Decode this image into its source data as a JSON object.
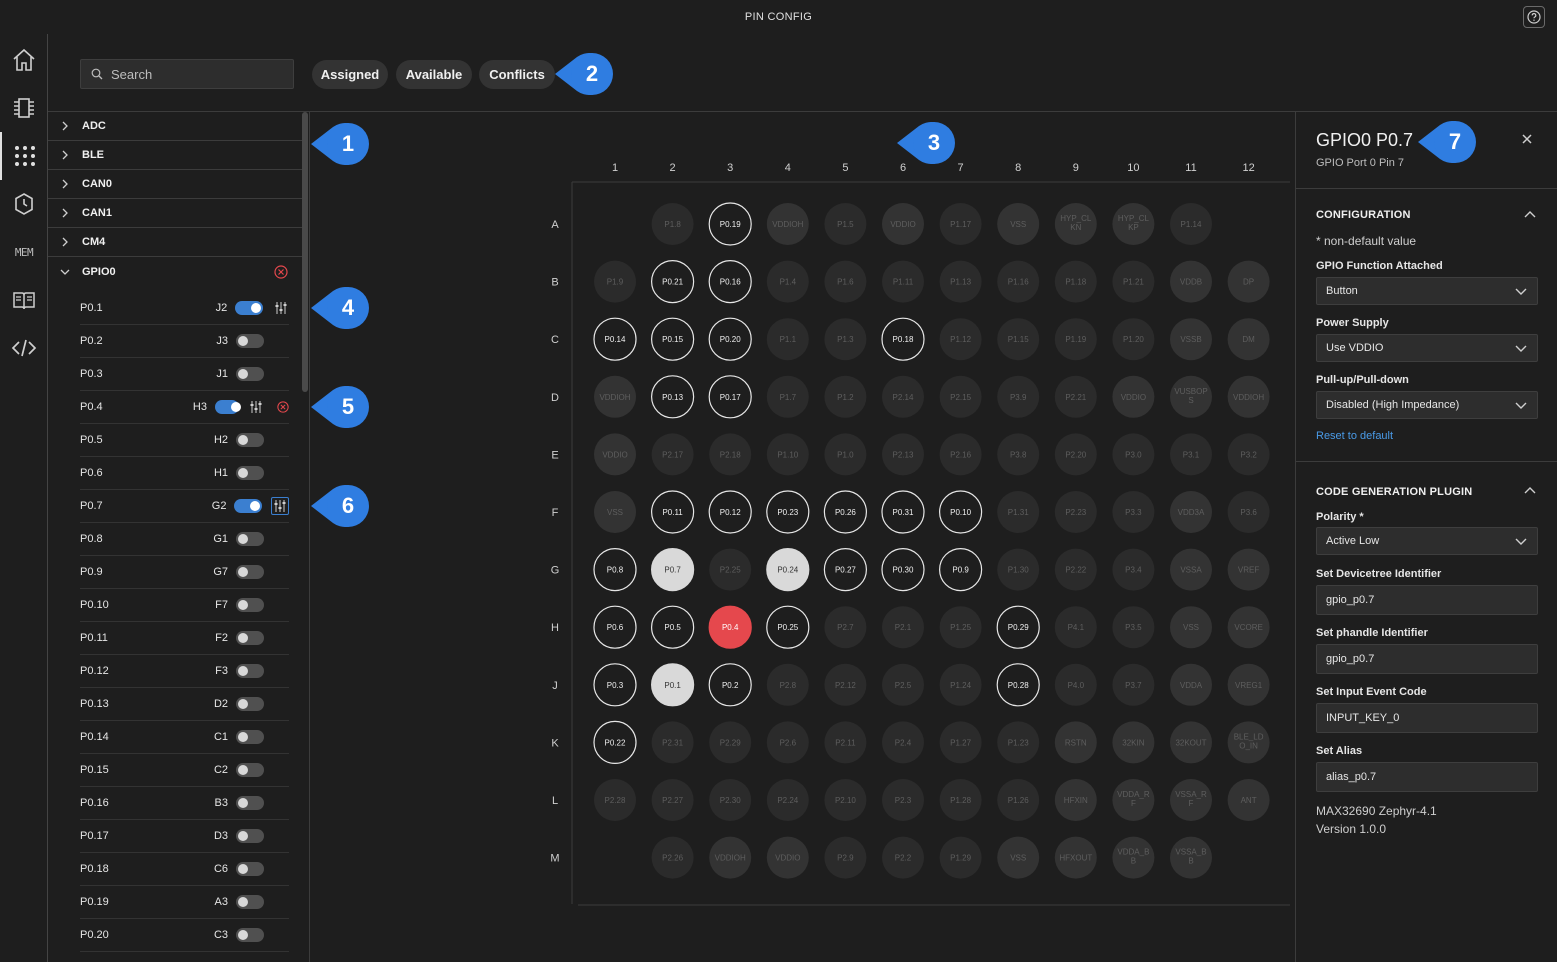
{
  "window": {
    "title": "PIN CONFIG"
  },
  "activity_bar": [
    {
      "name": "home-icon"
    },
    {
      "name": "device-icon"
    },
    {
      "name": "pin-grid-icon",
      "active": true
    },
    {
      "name": "clock-icon"
    },
    {
      "name": "mem-icon",
      "label": "MEM"
    },
    {
      "name": "book-icon"
    },
    {
      "name": "code-icon"
    }
  ],
  "toolbar": {
    "search_placeholder": "Search",
    "filters": [
      "Assigned",
      "Available",
      "Conflicts"
    ]
  },
  "callouts": [
    "1",
    "2",
    "3",
    "4",
    "5",
    "6",
    "7"
  ],
  "peripherals": {
    "collapsed_groups": [
      "ADC",
      "BLE",
      "CAN0",
      "CAN1",
      "CM4"
    ],
    "expanded_group": {
      "label": "GPIO0",
      "has_conflict": true
    },
    "pins": [
      {
        "name": "P0.1",
        "loc": "J2",
        "on": true,
        "tune": true
      },
      {
        "name": "P0.2",
        "loc": "J3",
        "on": false
      },
      {
        "name": "P0.3",
        "loc": "J1",
        "on": false
      },
      {
        "name": "P0.4",
        "loc": "H3",
        "on": true,
        "tune": true,
        "conflict": true
      },
      {
        "name": "P0.5",
        "loc": "H2",
        "on": false
      },
      {
        "name": "P0.6",
        "loc": "H1",
        "on": false
      },
      {
        "name": "P0.7",
        "loc": "G2",
        "on": true,
        "tune": true,
        "selected": true
      },
      {
        "name": "P0.8",
        "loc": "G1",
        "on": false
      },
      {
        "name": "P0.9",
        "loc": "G7",
        "on": false
      },
      {
        "name": "P0.10",
        "loc": "F7",
        "on": false
      },
      {
        "name": "P0.11",
        "loc": "F2",
        "on": false
      },
      {
        "name": "P0.12",
        "loc": "F3",
        "on": false
      },
      {
        "name": "P0.13",
        "loc": "D2",
        "on": false
      },
      {
        "name": "P0.14",
        "loc": "C1",
        "on": false
      },
      {
        "name": "P0.15",
        "loc": "C2",
        "on": false
      },
      {
        "name": "P0.16",
        "loc": "B3",
        "on": false
      },
      {
        "name": "P0.17",
        "loc": "D3",
        "on": false
      },
      {
        "name": "P0.18",
        "loc": "C6",
        "on": false
      },
      {
        "name": "P0.19",
        "loc": "A3",
        "on": false
      },
      {
        "name": "P0.20",
        "loc": "C3",
        "on": false
      }
    ]
  },
  "package": {
    "columns": [
      "1",
      "2",
      "3",
      "4",
      "5",
      "6",
      "7",
      "8",
      "9",
      "10",
      "11",
      "12"
    ],
    "rows": [
      "A",
      "B",
      "C",
      "D",
      "E",
      "F",
      "G",
      "H",
      "J",
      "K",
      "L",
      "M"
    ],
    "pins": [
      [
        "",
        "P1.8",
        "P0.19",
        "VDDIOH",
        "P1.5",
        "VDDIO",
        "P1.17",
        "VSS",
        "HYP_CL KN",
        "HYP_CL KP",
        "P1.14",
        ""
      ],
      [
        "P1.9",
        "P0.21",
        "P0.16",
        "P1.4",
        "P1.6",
        "P1.11",
        "P1.13",
        "P1.16",
        "P1.18",
        "P1.21",
        "VDDB",
        "DP"
      ],
      [
        "P0.14",
        "P0.15",
        "P0.20",
        "P1.1",
        "P1.3",
        "P0.18",
        "P1.12",
        "P1.15",
        "P1.19",
        "P1.20",
        "VSSB",
        "DM"
      ],
      [
        "VDDIOH",
        "P0.13",
        "P0.17",
        "P1.7",
        "P1.2",
        "P2.14",
        "P2.15",
        "P3.9",
        "P2.21",
        "VDDIO",
        "VUSBOP S",
        "VDDIOH"
      ],
      [
        "VDDIO",
        "P2.17",
        "P2.18",
        "P1.10",
        "P1.0",
        "P2.13",
        "P2.16",
        "P3.8",
        "P2.20",
        "P3.0",
        "P3.1",
        "P3.2"
      ],
      [
        "VSS",
        "P0.11",
        "P0.12",
        "P0.23",
        "P0.26",
        "P0.31",
        "P0.10",
        "P1.31",
        "P2.23",
        "P3.3",
        "VDD3A",
        "P3.6"
      ],
      [
        "P0.8",
        "P0.7",
        "P2.25",
        "P0.24",
        "P0.27",
        "P0.30",
        "P0.9",
        "P1.30",
        "P2.22",
        "P3.4",
        "VSSA",
        "VREF"
      ],
      [
        "P0.6",
        "P0.5",
        "P0.4",
        "P0.25",
        "P2.7",
        "P2.1",
        "P1.25",
        "P0.29",
        "P4.1",
        "P3.5",
        "VSS",
        "VCORE"
      ],
      [
        "P0.3",
        "P0.1",
        "P0.2",
        "P2.8",
        "P2.12",
        "P2.5",
        "P1.24",
        "P0.28",
        "P4.0",
        "P3.7",
        "VDDA",
        "VREG1"
      ],
      [
        "P0.22",
        "P2.31",
        "P2.29",
        "P2.6",
        "P2.11",
        "P2.4",
        "P1.27",
        "P1.23",
        "RSTN",
        "32KIN",
        "32KOUT",
        "BLE_LD O_IN"
      ],
      [
        "P2.28",
        "P2.27",
        "P2.30",
        "P2.24",
        "P2.10",
        "P2.3",
        "P1.28",
        "P1.26",
        "HFXIN",
        "VDDA_R F",
        "VSSA_R F",
        "ANT"
      ],
      [
        "",
        "P2.26",
        "VDDIOH",
        "VDDIO",
        "P2.9",
        "P2.2",
        "P1.29",
        "VSS",
        "HFXOUT",
        "VDDA_B B",
        "VSSA_B B",
        ""
      ]
    ],
    "states": [
      "0000000000000",
      "_nau0u0uuun_",
      "naanuuuuuuun",
      "aaauuauuuuuu",
      "uaauuuuuuuuu",
      "uuuuuuuuuuuu",
      "uaaaaaauuuuu",
      "asuSaaauuuuu",
      "aacauuuuuuuu",
      "asauuuuuuuuu",
      "auuuuuuuuuuu",
      "uuuuuuuuuuuu",
      "_uuuuuuuuuu_"
    ],
    "highlight": {
      "selected": [
        "P0.7",
        "P0.1"
      ],
      "conflict": [
        "P0.4"
      ],
      "hover": [
        "P0.24"
      ]
    }
  },
  "details": {
    "title": "GPIO0 P0.7",
    "subtitle": "GPIO Port 0 Pin 7",
    "config_section": "CONFIGURATION",
    "note": "* non-default value",
    "fields": [
      {
        "label": "GPIO Function Attached",
        "value": "Button"
      },
      {
        "label": "Power Supply",
        "value": "Use VDDIO"
      },
      {
        "label": "Pull-up/Pull-down",
        "value": "Disabled (High Impedance)"
      }
    ],
    "reset_link": "Reset to default",
    "codegen_section": "CODE GENERATION PLUGIN",
    "polarity": {
      "label": "Polarity *",
      "value": "Active Low"
    },
    "inputs": [
      {
        "label": "Set Devicetree Identifier",
        "value": "gpio_p0.7"
      },
      {
        "label": "Set phandle Identifier",
        "value": "gpio_p0.7"
      },
      {
        "label": "Set Input Event Code",
        "value": "INPUT_KEY_0"
      },
      {
        "label": "Set Alias",
        "value": "alias_p0.7"
      }
    ],
    "footer": {
      "device": "MAX32690 Zephyr-4.1",
      "version": "Version 1.0.0"
    }
  },
  "colors": {
    "accent": "#3b7fd0",
    "callout": "#2f7de1",
    "conflict": "#e5484d",
    "selected_pin": "#d9d9d9"
  }
}
